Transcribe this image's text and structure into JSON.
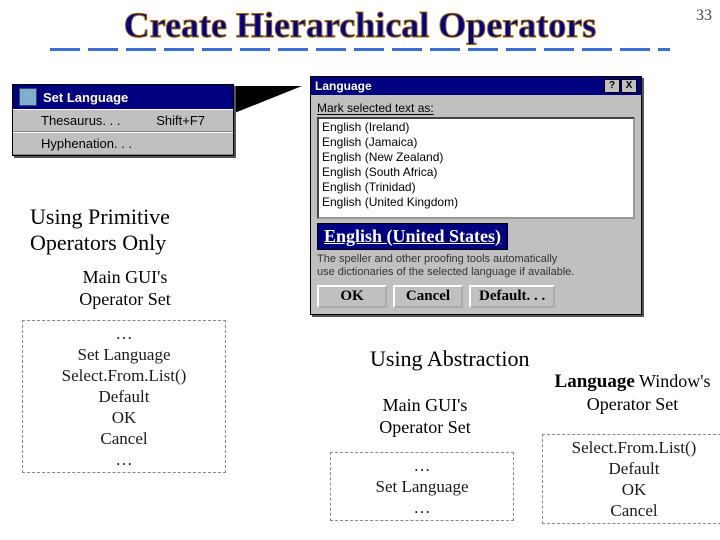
{
  "slide_number": "33",
  "title": "Create Hierarchical Operators",
  "menu": {
    "selected": "Set Language",
    "items": [
      {
        "label": "Thesaurus. . .",
        "accel": "Shift+F7"
      },
      {
        "label": "Hyphenation. . .",
        "accel": ""
      }
    ]
  },
  "dialog": {
    "title": "Language",
    "label": "Mark selected text as:",
    "options": [
      "English (Ireland)",
      "English (Jamaica)",
      "English (New Zealand)",
      "English (South Africa)",
      "English (Trinidad)",
      "English (United Kingdom)"
    ],
    "selected": "English (United States)",
    "hint1": "The speller and other proofing tools automatically",
    "hint2": "use dictionaries of the selected language if available.",
    "buttons": {
      "ok": "OK",
      "cancel": "Cancel",
      "default": "Default. . ."
    }
  },
  "left": {
    "heading_line1": "Using Primitive",
    "heading_line2": "Operators Only",
    "sub_line1": "Main GUI's",
    "sub_line2": "Operator Set",
    "items": [
      "…",
      "Set Language",
      "Select.From.List()",
      "Default",
      "OK",
      "Cancel",
      "…"
    ]
  },
  "right": {
    "heading": "Using Abstraction",
    "main_line1": "Main GUI's",
    "main_line2": "Operator Set",
    "main_items": [
      "…",
      "Set Language",
      "…"
    ],
    "lang_word": "Language",
    "lang_rest": " Window's",
    "lang_line2": "Operator Set",
    "lang_items": [
      "Select.From.List()",
      "Default",
      "OK",
      "Cancel"
    ]
  }
}
